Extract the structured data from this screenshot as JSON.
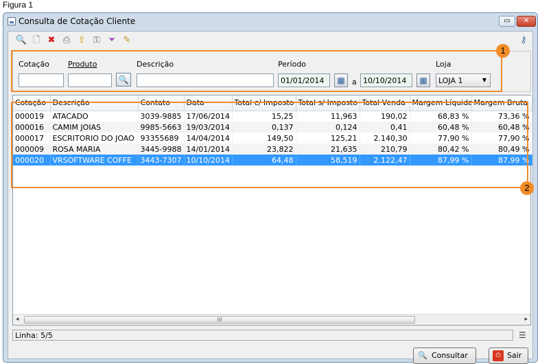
{
  "caption": "Figura 1",
  "window": {
    "title": "Consulta de Cotação Cliente",
    "restore_glyph": "▭",
    "close_glyph": "✕"
  },
  "toolbar": {
    "icons": [
      "search-icon",
      "new-document-icon",
      "delete-icon",
      "print-icon",
      "export-icon",
      "key-icon",
      "filter-icon",
      "edit-icon"
    ],
    "glyphs": [
      "🔍",
      "🗋",
      "✖",
      "⎙",
      "⇪",
      "⚿",
      "⏷",
      "✎"
    ],
    "help_icon_glyph": "⚷"
  },
  "filters": {
    "cotacao_label": "Cotação",
    "cotacao_value": "",
    "produto_label": "Produto",
    "produto_value": "",
    "descricao_label": "Descrição",
    "descricao_value": "",
    "periodo_label": "Período",
    "date_from": "01/01/2014",
    "date_sep": "a",
    "date_to": "10/10/2014",
    "loja_label": "Loja",
    "loja_value": "LOJA 1",
    "calendar_glyph": "▦",
    "search_glyph": "🔍",
    "arrow_glyph": "▼"
  },
  "table": {
    "columns": [
      "Cotação",
      "Descrição",
      "Contato",
      "Data",
      "Total c/ Imposto",
      "Total s/ Imposto",
      "Total Venda",
      "Margem Líquida",
      "Margem Bruta"
    ],
    "rows": [
      [
        "000019",
        "ATACADO",
        "3039-9885",
        "17/06/2014",
        "15,25",
        "11,963",
        "190,02",
        "68,83 %",
        "73,36 %"
      ],
      [
        "000016",
        "CAMIM JOIAS",
        "9985-5663",
        "19/03/2014",
        "0,137",
        "0,124",
        "0,41",
        "60,48 %",
        "60,48 %"
      ],
      [
        "000017",
        "ESCRITORIO DO JOAO",
        "93355689",
        "14/04/2014",
        "149,50",
        "125,21",
        "2.140,30",
        "77,90 %",
        "77,90 %"
      ],
      [
        "000009",
        "ROSA MARIA",
        "3445-9988",
        "14/01/2014",
        "23,822",
        "21,635",
        "210,79",
        "80,42 %",
        "80,49 %"
      ],
      [
        "000020",
        "VRSOFTWARE COFFE",
        "3443-7307",
        "10/10/2014",
        "64,48",
        "58,519",
        "2.122,47",
        "87,99 %",
        "87,99 %"
      ]
    ],
    "selected_row": 4
  },
  "scrollbar": {
    "left": "◂",
    "right": "▸",
    "grip": "III"
  },
  "status": {
    "text": "Linha: 5/5",
    "menu_glyph": "☰"
  },
  "buttons": {
    "consultar": "Consultar",
    "consultar_glyph": "🔍",
    "sair": "Sair",
    "sair_glyph": "⏻"
  },
  "markers": {
    "one": "1",
    "two": "2"
  },
  "colors": {
    "selection": "#3399ff",
    "marker": "#ef8b2c"
  }
}
